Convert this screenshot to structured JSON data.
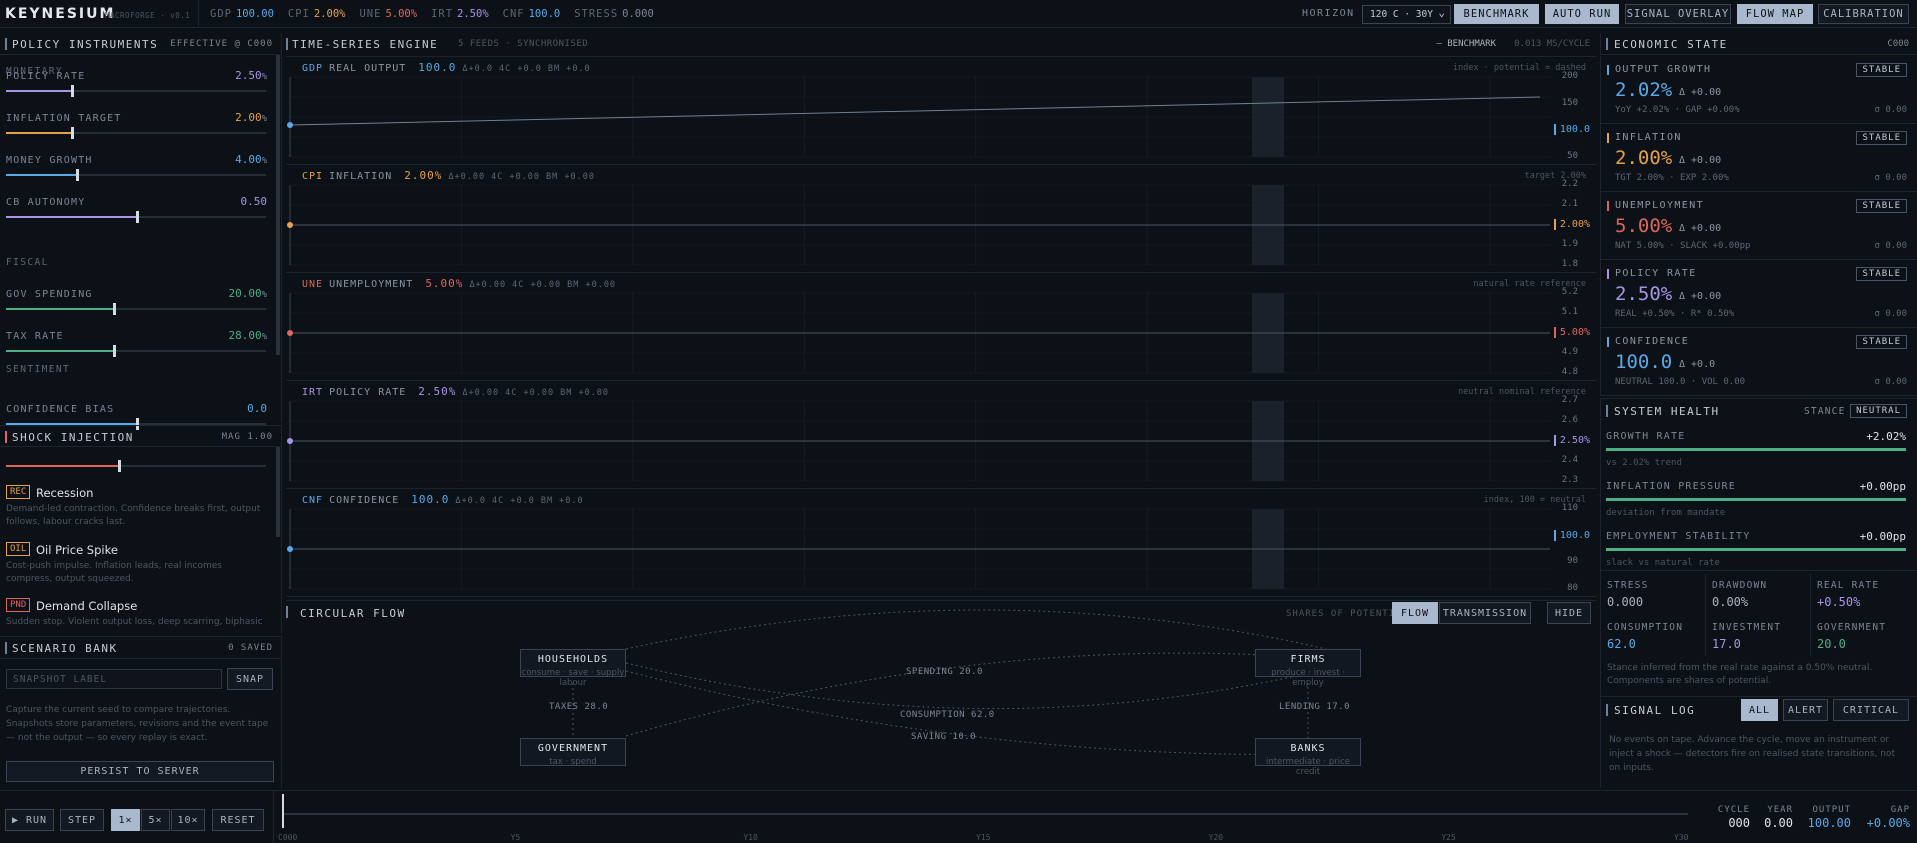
{
  "topbar": {
    "brand": "KEYNESIUM",
    "subbrand": "MACROFORGE · v0.1",
    "metrics": [
      {
        "k": "GDP",
        "v": "100.00",
        "color": "#5aa9e6"
      },
      {
        "k": "CPI",
        "v": "2.00%",
        "color": "#e6a14c"
      },
      {
        "k": "UNE",
        "v": "5.00%",
        "color": "#e0665b"
      },
      {
        "k": "IRT",
        "v": "2.50%",
        "color": "#a995e6"
      },
      {
        "k": "CNF",
        "v": "100.0",
        "color": "#5aa9e6"
      },
      {
        "k": "STRESS",
        "v": "0.000",
        "color": "#7b8695"
      }
    ],
    "horizon_label": "HORIZON",
    "horizon_value": "120 C · 30Y",
    "buttons": [
      "BENCHMARK",
      "AUTO RUN",
      "SIGNAL OVERLAY",
      "FLOW MAP",
      "CALIBRATION"
    ]
  },
  "policy": {
    "title": "POLICY INSTRUMENTS",
    "effective": "EFFECTIVE @ C000",
    "monetary_label": "MONETARY",
    "fiscal_label": "FISCAL",
    "sentiment_label": "SENTIMENT",
    "controls": [
      {
        "label": "POLICY RATE",
        "value": "2.50",
        "unit": "%",
        "fraction": 0.25,
        "color": "#a995e6"
      },
      {
        "label": "INFLATION TARGET",
        "value": "2.00",
        "unit": "%",
        "fraction": 0.25,
        "color": "#e6a14c"
      },
      {
        "label": "MONEY GROWTH",
        "value": "4.00",
        "unit": "%",
        "fraction": 0.27,
        "color": "#5aa9e6"
      },
      {
        "label": "CB AUTONOMY",
        "value": "0.50",
        "unit": "",
        "fraction": 0.5,
        "color": "#a995e6"
      },
      {
        "label": "GOV SPENDING",
        "value": "20.00",
        "unit": "%",
        "fraction": 0.41,
        "color": "#4fae86"
      },
      {
        "label": "TAX RATE",
        "value": "28.00",
        "unit": "%",
        "fraction": 0.41,
        "color": "#4fae86"
      },
      {
        "label": "CONFIDENCE BIAS",
        "value": "0.0",
        "unit": "",
        "fraction": 0.5,
        "color": "#5aa9e6"
      }
    ]
  },
  "shock": {
    "title": "SHOCK INJECTION",
    "mag": "MAG 1.00",
    "mag_fraction": 0.43,
    "items": [
      {
        "tag": "REC",
        "name": "Recession",
        "desc": "Demand-led contraction. Confidence breaks first, output follows, labour cracks last."
      },
      {
        "tag": "OIL",
        "name": "Oil Price Spike",
        "desc": "Cost-push impulse. Inflation leads, real incomes compress, output squeezed."
      },
      {
        "tag": "PND",
        "name": "Demand Collapse",
        "desc": "Sudden stop. Violent output loss, deep scarring, biphasic"
      }
    ]
  },
  "scenario": {
    "title": "SCENARIO BANK",
    "saved": "0 SAVED",
    "placeholder": "SNAPSHOT LABEL",
    "snap": "SNAP",
    "desc": "Capture the current seed to compare trajectories. Snapshots store parameters, revisions and the event tape — not the output — so every replay is exact.",
    "persist": "PERSIST TO SERVER"
  },
  "engine": {
    "title": "TIME-SERIES ENGINE",
    "feeds": "5 FEEDS · SYNCHRONISED",
    "benchmark": "— BENCHMARK",
    "speed": "0.013 MS/CYCLE",
    "charts": [
      {
        "code": "GDP",
        "name": "REAL OUTPUT",
        "value": "100.0",
        "delta": "Δ+0.0",
        "c4": "4C +0.0",
        "bm": "BM +0.0",
        "note": "index · potential = dashed",
        "color": "#5aa9e6",
        "ticks": [
          "200",
          "150",
          "100.0",
          "50"
        ],
        "current": "100.0"
      },
      {
        "code": "CPI",
        "name": "INFLATION",
        "value": "2.00%",
        "delta": "Δ+0.00",
        "c4": "4C +0.00",
        "bm": "BM +0.00",
        "note": "target 2.00%",
        "color": "#e6a14c",
        "ticks": [
          "2.2",
          "2.1",
          "2.00%",
          "1.9",
          "1.8"
        ],
        "current": "2.00%"
      },
      {
        "code": "UNE",
        "name": "UNEMPLOYMENT",
        "value": "5.00%",
        "delta": "Δ+0.00",
        "c4": "4C +0.00",
        "bm": "BM +0.00",
        "note": "natural rate reference",
        "color": "#e0665b",
        "ticks": [
          "5.2",
          "5.1",
          "5.00%",
          "4.9",
          "4.8"
        ],
        "current": "5.00%"
      },
      {
        "code": "IRT",
        "name": "POLICY RATE",
        "value": "2.50%",
        "delta": "Δ+0.00",
        "c4": "4C +0.00",
        "bm": "BM +0.00",
        "note": "neutral nominal reference",
        "color": "#a995e6",
        "ticks": [
          "2.7",
          "2.6",
          "2.50%",
          "2.4",
          "2.3"
        ],
        "current": "2.50%"
      },
      {
        "code": "CNF",
        "name": "CONFIDENCE",
        "value": "100.0",
        "delta": "Δ+0.0",
        "c4": "4C +0.0",
        "bm": "BM +0.0",
        "note": "index, 100 = neutral",
        "color": "#5aa9e6",
        "ticks": [
          "110",
          "100.0",
          "90",
          "80"
        ],
        "current": "100.0"
      }
    ]
  },
  "flow": {
    "title": "CIRCULAR FLOW",
    "shares": "SHARES OF POTENTIAL",
    "buttons": [
      "FLOW",
      "TRANSMISSION",
      "HIDE"
    ],
    "nodes": [
      {
        "name": "HOUSEHOLDS",
        "sub": "consume · save · supply labour"
      },
      {
        "name": "FIRMS",
        "sub": "produce · invest · employ"
      },
      {
        "name": "GOVERNMENT",
        "sub": "tax · spend"
      },
      {
        "name": "BANKS",
        "sub": "intermediate · price credit"
      }
    ],
    "labels": [
      "SPENDING 20.0",
      "CONSUMPTION 62.0",
      "SAVING 10.0",
      "TAXES 28.0",
      "LENDING 17.0"
    ]
  },
  "econ": {
    "title": "ECONOMIC STATE",
    "cycle": "C000",
    "cards": [
      {
        "label": "OUTPUT GROWTH",
        "big": "2.02%",
        "delta": "Δ +0.00",
        "sub": "YoY +2.02% · GAP +0.00%",
        "sigma": "σ 0.00",
        "badge": "STABLE",
        "color": "#5aa9e6"
      },
      {
        "label": "INFLATION",
        "big": "2.00%",
        "delta": "Δ +0.00",
        "sub": "TGT 2.00% · EXP 2.00%",
        "sigma": "σ 0.00",
        "badge": "STABLE",
        "color": "#e6a14c"
      },
      {
        "label": "UNEMPLOYMENT",
        "big": "5.00%",
        "delta": "Δ +0.00",
        "sub": "NAT 5.00% · SLACK +0.00pp",
        "sigma": "σ 0.00",
        "badge": "STABLE",
        "color": "#e0665b"
      },
      {
        "label": "POLICY RATE",
        "big": "2.50%",
        "delta": "Δ +0.00",
        "sub": "REAL +0.50% · R* 0.50%",
        "sigma": "σ 0.00",
        "badge": "STABLE",
        "color": "#a995e6"
      },
      {
        "label": "CONFIDENCE",
        "big": "100.0",
        "delta": "Δ +0.0",
        "sub": "NEUTRAL 100.0 · VOL 0.00",
        "sigma": "σ 0.00",
        "badge": "STABLE",
        "color": "#5aa9e6"
      }
    ]
  },
  "health": {
    "title": "SYSTEM HEALTH",
    "stance_label": "STANCE",
    "stance": "NEUTRAL",
    "rows": [
      {
        "label": "GROWTH RATE",
        "value": "+2.02%",
        "sub": "vs 2.02% trend"
      },
      {
        "label": "INFLATION PRESSURE",
        "value": "+0.00pp",
        "sub": "deviation from mandate"
      },
      {
        "label": "EMPLOYMENT STABILITY",
        "value": "+0.00pp",
        "sub": "slack vs natural rate"
      }
    ],
    "kpis": [
      {
        "label": "STRESS",
        "value": "0.000",
        "color": "#a9b3c0"
      },
      {
        "label": "DRAWDOWN",
        "value": "0.00%",
        "color": "#a9b3c0"
      },
      {
        "label": "REAL RATE",
        "value": "+0.50%",
        "color": "#a995e6"
      },
      {
        "label": "CONSUMPTION",
        "value": "62.0",
        "color": "#5aa9e6"
      },
      {
        "label": "INVESTMENT",
        "value": "17.0",
        "color": "#a995e6"
      },
      {
        "label": "GOVERNMENT",
        "value": "20.0",
        "color": "#4fae86"
      }
    ],
    "note": "Stance inferred from the real rate against a 0.50% neutral. Components are shares of potential."
  },
  "signal": {
    "title": "SIGNAL LOG",
    "filters": [
      "ALL",
      "ALERT",
      "CRITICAL"
    ],
    "empty": "No events on tape. Advance the cycle, move an instrument or inject a shock — detectors fire on realised state transitions, not on inputs."
  },
  "transport": {
    "run": "▶ RUN",
    "step": "STEP",
    "speeds": [
      "1×",
      "5×",
      "10×"
    ],
    "reset": "RESET",
    "timeline": [
      "C000",
      "Y5",
      "Y10",
      "Y15",
      "Y20",
      "Y25",
      "Y30"
    ],
    "readouts": [
      {
        "label": "CYCLE",
        "value": "000",
        "color": "#dfe4ea"
      },
      {
        "label": "YEAR",
        "value": "0.00",
        "color": "#dfe4ea"
      },
      {
        "label": "OUTPUT",
        "value": "100.00",
        "color": "#5aa9e6"
      },
      {
        "label": "GAP",
        "value": "+0.00%",
        "color": "#5aa9e6"
      }
    ]
  }
}
